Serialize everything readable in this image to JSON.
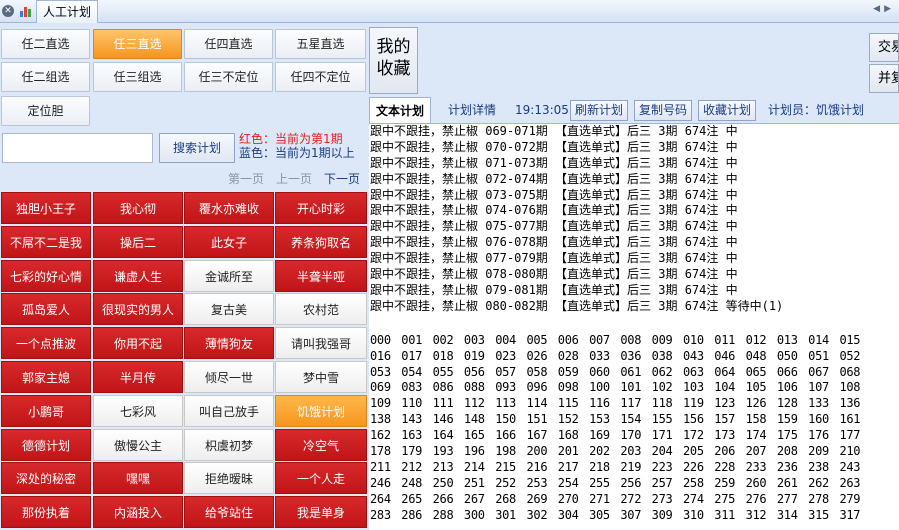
{
  "tab": {
    "title": "人工计划"
  },
  "modes": [
    {
      "label": "任二直选",
      "selected": false
    },
    {
      "label": "任三直选",
      "selected": true
    },
    {
      "label": "任四直选",
      "selected": false
    },
    {
      "label": "五星直选",
      "selected": false
    },
    {
      "label": "任二组选",
      "selected": false
    },
    {
      "label": "任三组选",
      "selected": false
    },
    {
      "label": "任三不定位",
      "selected": false
    },
    {
      "label": "任四不定位",
      "selected": false
    },
    {
      "label": "定位胆",
      "selected": false
    }
  ],
  "search": {
    "value": "",
    "button": "搜索计划"
  },
  "legend": {
    "red": "红色：当前为第1期",
    "blue": "蓝色：当前为1期以上"
  },
  "pager": {
    "first": "第一页",
    "prev": "上一页",
    "next": "下一页"
  },
  "planners": [
    {
      "name": "独胆小王子",
      "style": "red"
    },
    {
      "name": "我心彻",
      "style": "red"
    },
    {
      "name": "覆水亦难收",
      "style": "red"
    },
    {
      "name": "开心时彩",
      "style": "red"
    },
    {
      "name": "不屌不二是我",
      "style": "red"
    },
    {
      "name": "操后二",
      "style": "red"
    },
    {
      "name": "此女子",
      "style": "red"
    },
    {
      "name": "养条狗取名",
      "style": "red"
    },
    {
      "name": "七彩的好心情",
      "style": "red"
    },
    {
      "name": "谦虚人生",
      "style": "red"
    },
    {
      "name": "金诚所至",
      "style": "white"
    },
    {
      "name": "半聋半哑",
      "style": "red"
    },
    {
      "name": "孤岛爱人",
      "style": "red"
    },
    {
      "name": "很现实的男人",
      "style": "red"
    },
    {
      "name": "复古美",
      "style": "white"
    },
    {
      "name": "农村范",
      "style": "white"
    },
    {
      "name": "一个点推波",
      "style": "red"
    },
    {
      "name": "你用不起",
      "style": "red"
    },
    {
      "name": "薄情狗友",
      "style": "red"
    },
    {
      "name": "请叫我强哥",
      "style": "white"
    },
    {
      "name": "郭家主媳",
      "style": "red"
    },
    {
      "name": "半月传",
      "style": "red"
    },
    {
      "name": "倾尽一世",
      "style": "white"
    },
    {
      "name": "梦中雪",
      "style": "white"
    },
    {
      "name": "小鹏哥",
      "style": "red"
    },
    {
      "name": "七彩风",
      "style": "white"
    },
    {
      "name": "叫自己放手",
      "style": "white"
    },
    {
      "name": "饥饿计划",
      "style": "orange"
    },
    {
      "name": "德德计划",
      "style": "red"
    },
    {
      "name": "傲慢公主",
      "style": "white"
    },
    {
      "name": "枳虞初梦",
      "style": "white"
    },
    {
      "name": "冷空气",
      "style": "red"
    },
    {
      "name": "深处的秘密",
      "style": "red"
    },
    {
      "name": "嘿嘿",
      "style": "red"
    },
    {
      "name": "拒绝暧昧",
      "style": "white"
    },
    {
      "name": "一个人走",
      "style": "red"
    },
    {
      "name": "那份执着",
      "style": "red"
    },
    {
      "name": "内涵投入",
      "style": "red"
    },
    {
      "name": "给爷站住",
      "style": "red"
    },
    {
      "name": "我是单身",
      "style": "red"
    }
  ],
  "favorites_button": "我的收藏",
  "right_buttons": [
    "交易",
    "并复"
  ],
  "toolbar": {
    "tab_text": "文本计划",
    "tab_detail": "计划详情",
    "time": "19:13:05",
    "refresh": "刷新计划",
    "copy": "复制号码",
    "collect": "收藏计划",
    "planner_label": "计划员：饥饿计划"
  },
  "plan_lines": [
    "跟中不跟挂，禁止椒 069-071期 【直选单式】后三 3期 674注 中",
    "跟中不跟挂，禁止椒 070-072期 【直选单式】后三 3期 674注 中",
    "跟中不跟挂，禁止椒 071-073期 【直选单式】后三 3期 674注 中",
    "跟中不跟挂，禁止椒 072-074期 【直选单式】后三 3期 674注 中",
    "跟中不跟挂，禁止椒 073-075期 【直选单式】后三 3期 674注 中",
    "跟中不跟挂，禁止椒 074-076期 【直选单式】后三 3期 674注 中",
    "跟中不跟挂，禁止椒 075-077期 【直选单式】后三 3期 674注 中",
    "跟中不跟挂，禁止椒 076-078期 【直选单式】后三 3期 674注 中",
    "跟中不跟挂，禁止椒 077-079期 【直选单式】后三 3期 674注 中",
    "跟中不跟挂，禁止椒 078-080期 【直选单式】后三 3期 674注 中",
    "跟中不跟挂，禁止椒 079-081期 【直选单式】后三 3期 674注 中",
    "跟中不跟挂，禁止椒 080-082期 【直选单式】后三 3期 674注 等待中(1)"
  ],
  "numbers": [
    "000",
    "001",
    "002",
    "003",
    "004",
    "005",
    "006",
    "007",
    "008",
    "009",
    "010",
    "011",
    "012",
    "013",
    "014",
    "015",
    "016",
    "017",
    "018",
    "019",
    "023",
    "026",
    "028",
    "033",
    "036",
    "038",
    "043",
    "046",
    "048",
    "050",
    "051",
    "052",
    "053",
    "054",
    "055",
    "056",
    "057",
    "058",
    "059",
    "060",
    "061",
    "062",
    "063",
    "064",
    "065",
    "066",
    "067",
    "068",
    "069",
    "083",
    "086",
    "088",
    "093",
    "096",
    "098",
    "100",
    "101",
    "102",
    "103",
    "104",
    "105",
    "106",
    "107",
    "108",
    "109",
    "110",
    "111",
    "112",
    "113",
    "114",
    "115",
    "116",
    "117",
    "118",
    "119",
    "123",
    "126",
    "128",
    "133",
    "136",
    "138",
    "143",
    "146",
    "148",
    "150",
    "151",
    "152",
    "153",
    "154",
    "155",
    "156",
    "157",
    "158",
    "159",
    "160",
    "161",
    "162",
    "163",
    "164",
    "165",
    "166",
    "167",
    "168",
    "169",
    "170",
    "171",
    "172",
    "173",
    "174",
    "175",
    "176",
    "177",
    "178",
    "179",
    "193",
    "196",
    "198",
    "200",
    "201",
    "202",
    "203",
    "204",
    "205",
    "206",
    "207",
    "208",
    "209",
    "210",
    "211",
    "212",
    "213",
    "214",
    "215",
    "216",
    "217",
    "218",
    "219",
    "223",
    "226",
    "228",
    "233",
    "236",
    "238",
    "243",
    "246",
    "248",
    "250",
    "251",
    "252",
    "253",
    "254",
    "255",
    "256",
    "257",
    "258",
    "259",
    "260",
    "261",
    "262",
    "263",
    "264",
    "265",
    "266",
    "267",
    "268",
    "269",
    "270",
    "271",
    "272",
    "273",
    "274",
    "275",
    "276",
    "277",
    "278",
    "279",
    "283",
    "286",
    "288",
    "300",
    "301",
    "302",
    "304",
    "305",
    "307",
    "309",
    "310",
    "311",
    "312",
    "314",
    "315",
    "317"
  ]
}
